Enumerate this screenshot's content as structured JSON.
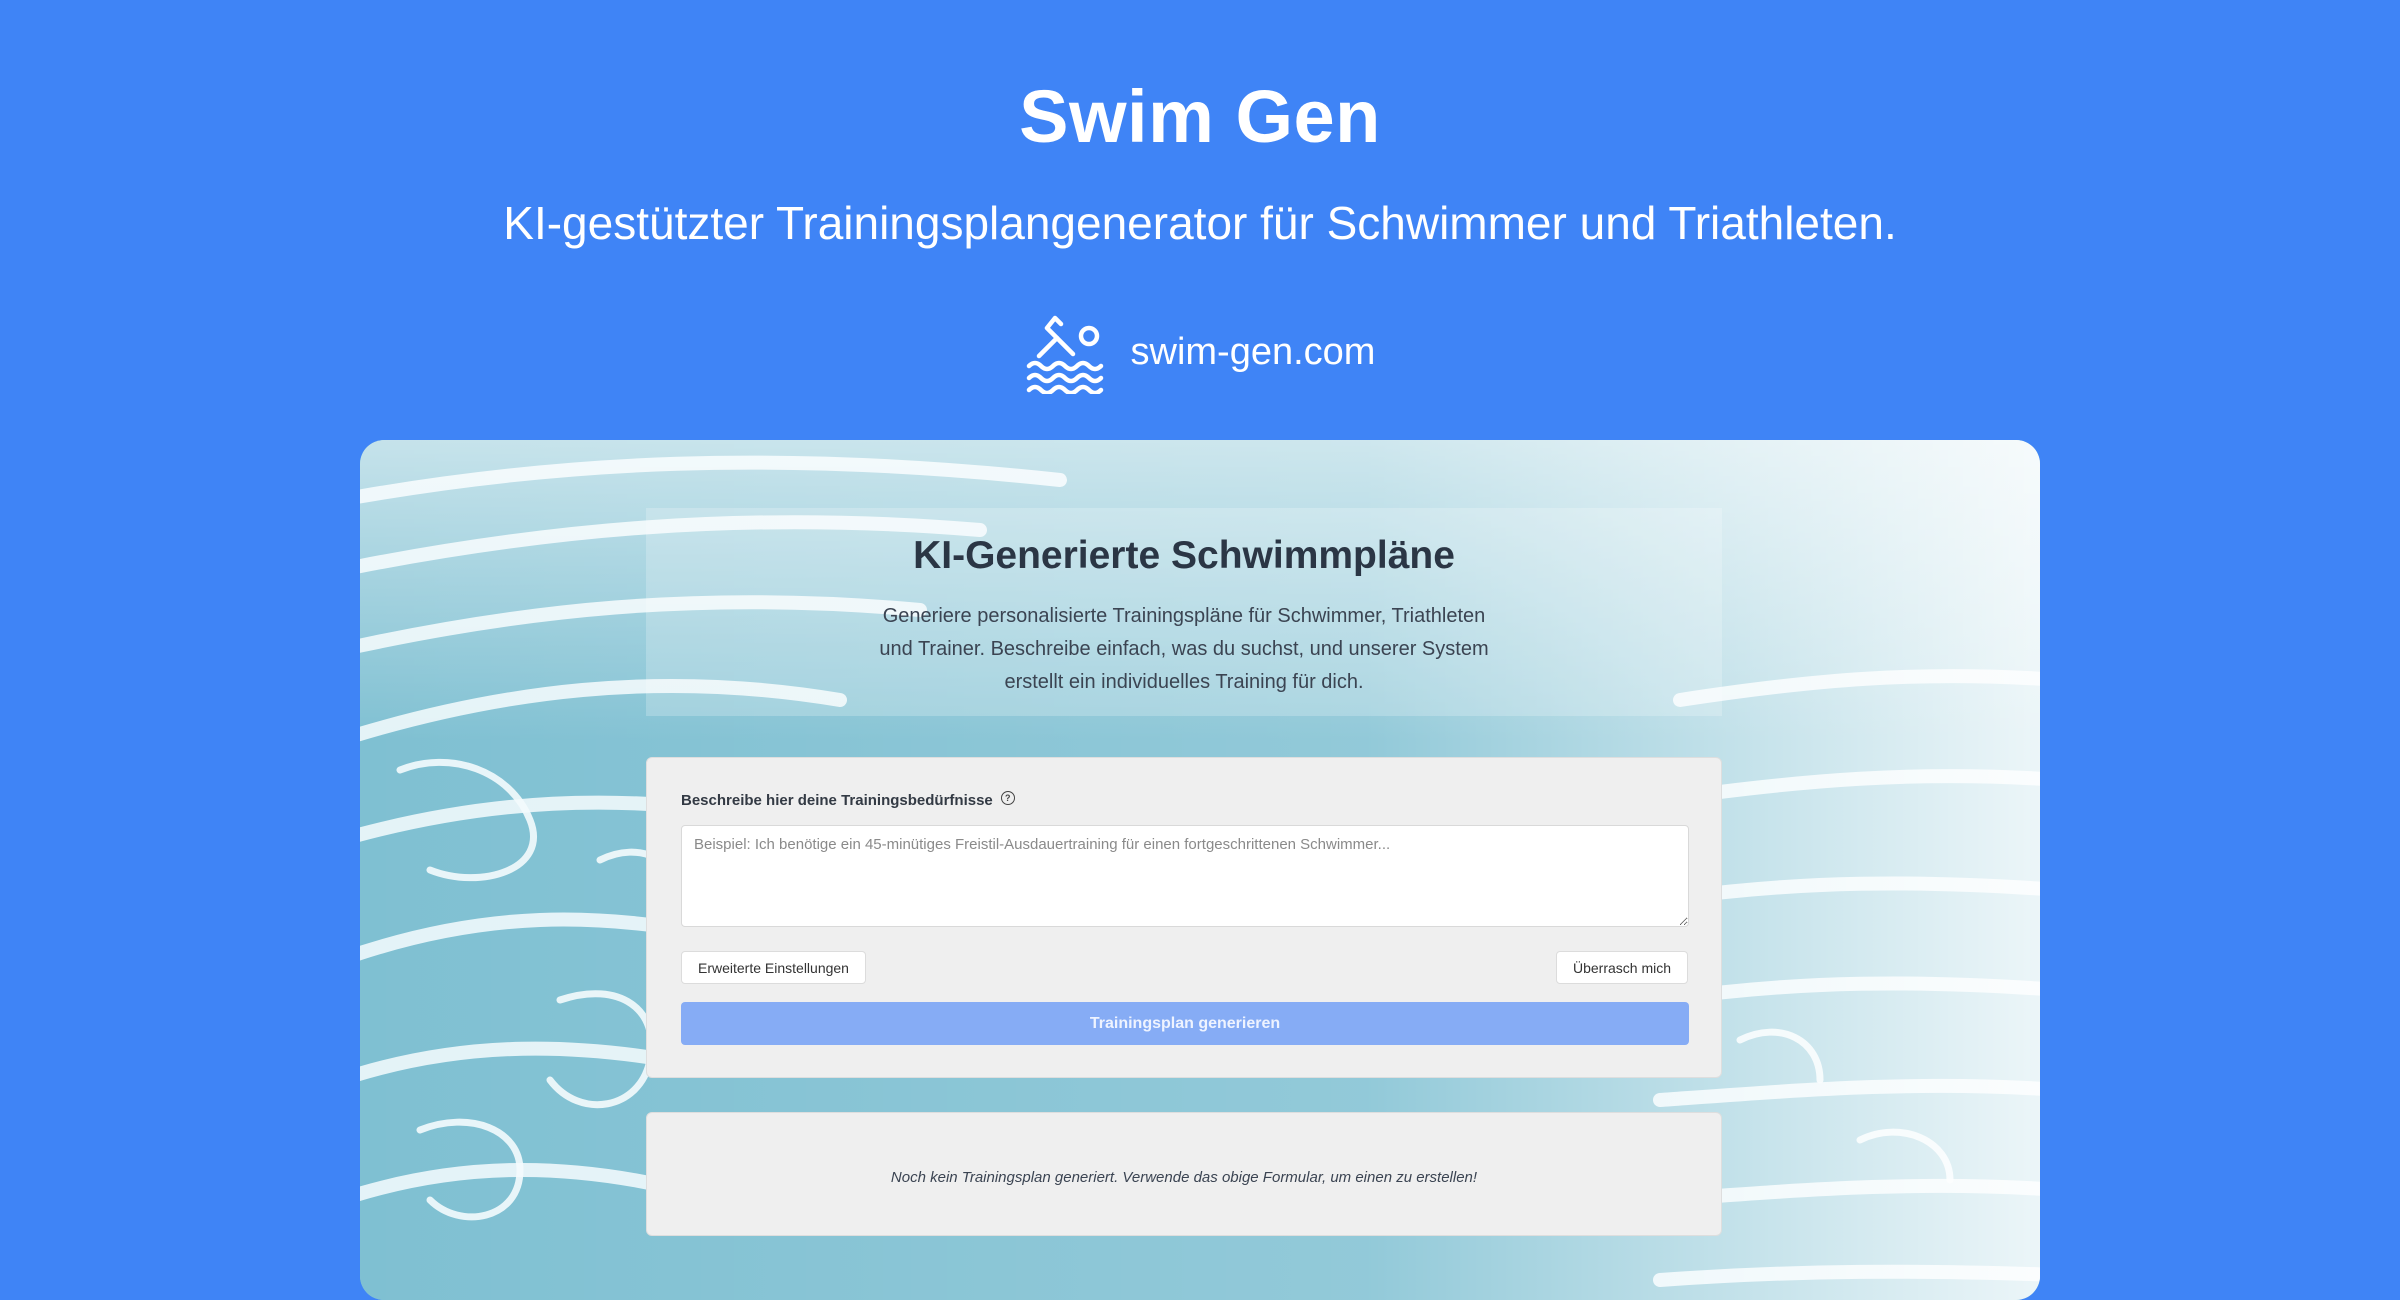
{
  "header": {
    "title": "Swim Gen",
    "subtitle": "KI-gestützter Trainingsplangenerator für Schwimmer und Triathleten.",
    "url": "swim-gen.com",
    "logo_icon": "swimmer-icon"
  },
  "colors": {
    "background": "#3f84f6",
    "panel": "#efefef",
    "generate_button": "#86acf5"
  },
  "intro": {
    "title": "KI-Generierte Schwimmpläne",
    "text": "Generiere personalisierte Trainingspläne für Schwimmer, Triathleten und Trainer. Beschreibe einfach, was du suchst, und unserer System erstellt ein individuelles Training für dich."
  },
  "form": {
    "label": "Beschreibe hier deine Trainingsbedürfnisse",
    "help_icon": "question-circle-icon",
    "help_glyph": "?",
    "input_value": "",
    "placeholder": "Beispiel: Ich benötige ein 45-minütiges Freistil-Ausdauertraining für einen fortgeschrittenen Schwimmer...",
    "advanced_button": "Erweiterte Einstellungen",
    "surprise_button": "Überrasch mich",
    "generate_button": "Trainingsplan generieren"
  },
  "result": {
    "empty_text": "Noch kein Trainingsplan generiert. Verwende das obige Formular, um einen zu erstellen!"
  }
}
